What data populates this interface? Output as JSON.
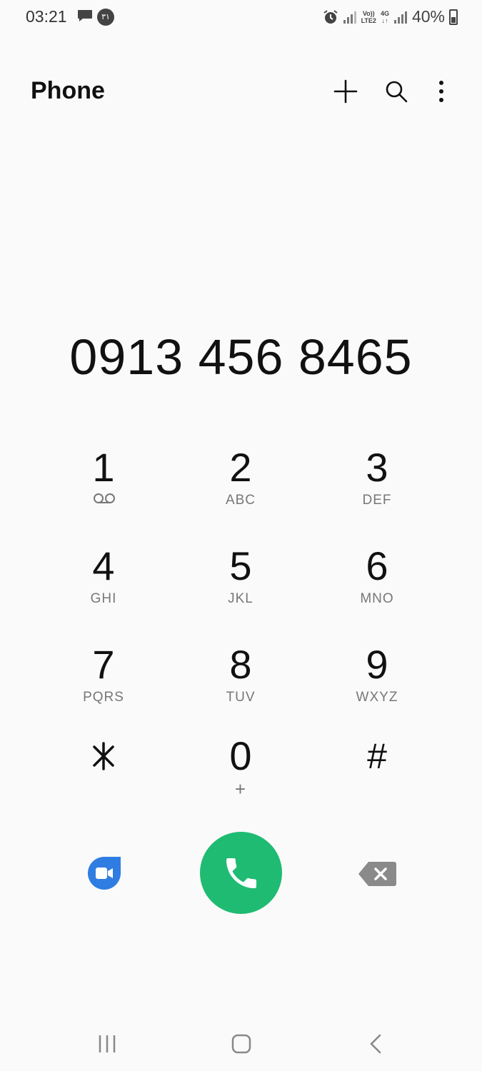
{
  "colors": {
    "background": "#fafafa",
    "call_green": "#1fbb73",
    "duo_blue": "#2f7de2",
    "icon_gray": "#8a8a8a"
  },
  "status_bar": {
    "time": "03:21",
    "calendar_badge": "۳۱",
    "volte_top": "Vo))",
    "volte_bottom": "LTE2",
    "network_type": "4G",
    "battery_percent": "40%",
    "icons": [
      "message-icon",
      "alarm-icon",
      "signal-icon",
      "signal-icon",
      "battery-icon"
    ]
  },
  "header": {
    "title": "Phone",
    "icons": [
      "add-icon",
      "search-icon",
      "more-vert-icon"
    ]
  },
  "dialed_number": "0913 456 8465",
  "keypad": {
    "keys": [
      {
        "digit": "1",
        "letters": "",
        "sub_icon": "voicemail-icon"
      },
      {
        "digit": "2",
        "letters": "ABC"
      },
      {
        "digit": "3",
        "letters": "DEF"
      },
      {
        "digit": "4",
        "letters": "GHI"
      },
      {
        "digit": "5",
        "letters": "JKL"
      },
      {
        "digit": "6",
        "letters": "MNO"
      },
      {
        "digit": "7",
        "letters": "PQRS"
      },
      {
        "digit": "8",
        "letters": "TUV"
      },
      {
        "digit": "9",
        "letters": "WXYZ"
      },
      {
        "digit": "⁎",
        "letters": ""
      },
      {
        "digit": "0",
        "letters": "+"
      },
      {
        "digit": "#",
        "letters": ""
      }
    ]
  },
  "actions": {
    "video": "video-call-icon",
    "call": "phone-icon",
    "delete": "backspace-icon"
  },
  "nav_bar": {
    "icons": [
      "recent-apps-icon",
      "home-icon",
      "back-icon"
    ]
  }
}
